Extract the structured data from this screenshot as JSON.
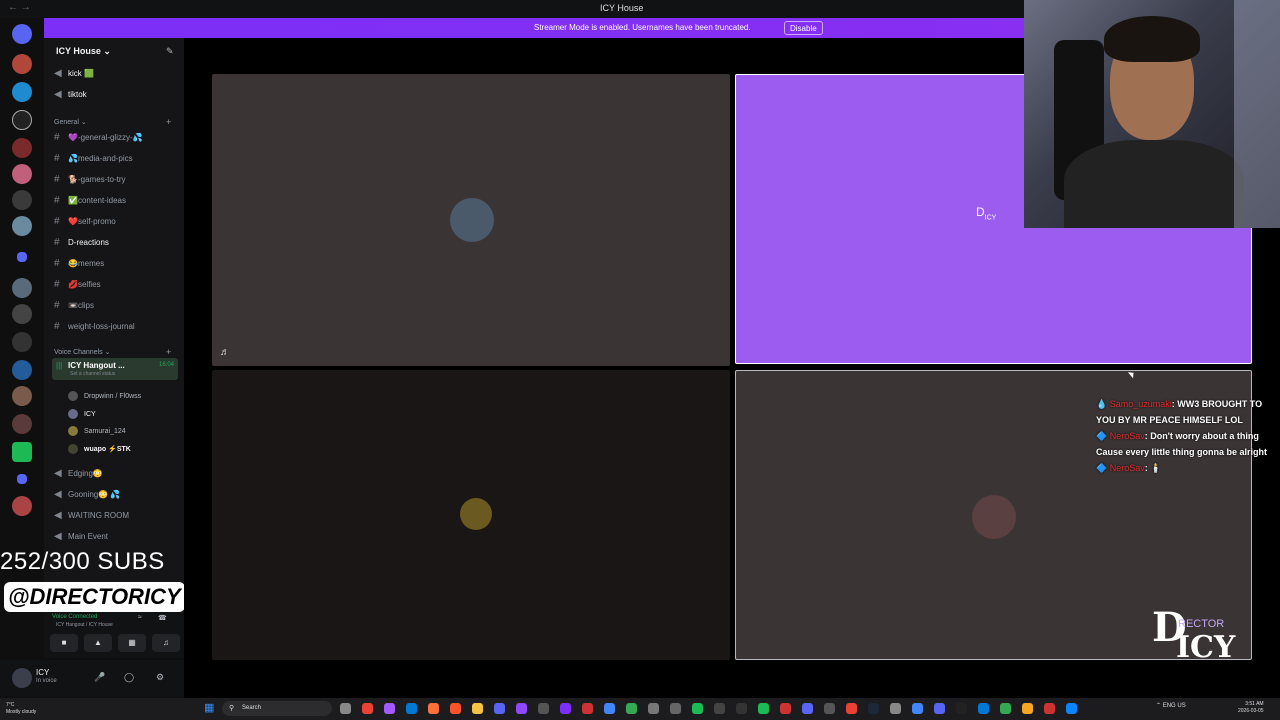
{
  "window": {
    "title": "ICY House"
  },
  "banner": {
    "message": "Streamer Mode is enabled. Usernames have been truncated.",
    "disable_label": "Disable"
  },
  "server": {
    "name": "ICY House ⌄"
  },
  "channels_top": [
    {
      "name": "kick 🟩",
      "icon": "speaker"
    },
    {
      "name": "tiktok",
      "icon": "speaker"
    }
  ],
  "category_general": "General ⌄",
  "text_channels": [
    "💜-general-glizzy-💦",
    "💦media-and-pics",
    "🐕-games-to-try",
    "✅content-ideas",
    "❤️self-promo",
    "D-reactions",
    "😂memes",
    "💋selfies",
    "📼clips",
    "weight-loss-journal"
  ],
  "category_voice": "Voice Channels ⌄",
  "active_voice": {
    "name": "ICY Hangout ...",
    "time": "16:04",
    "status": "Set a channel status"
  },
  "voice_users": [
    "Dropwinn / Fl0wss",
    "ICY",
    "Samurai_124",
    "wuapo ⚡STK"
  ],
  "other_voice": [
    "Edging😳",
    "Gooning😳 💦",
    "WAITING ROOM",
    "Main Event"
  ],
  "overlay": {
    "subs": "252/300 SUBS",
    "handle": "@DIRECTORICY"
  },
  "voicebar": {
    "label": "Voice Connected",
    "sub": "ICY Hangout / ICY House"
  },
  "user": {
    "name": "ICY",
    "status": "In voice"
  },
  "chat": [
    {
      "user": "Samo_uzumaki",
      "text": ": WW3 BROUGHT TO YOU BY MR PEACE HIMSELF LOL"
    },
    {
      "user": "NeroSav",
      "text": ": Don't worry about a thing Cause every little thing gonna be alright"
    },
    {
      "user": "NeroSav",
      "text": ": 🕯️"
    }
  ],
  "logo": {
    "d": "D",
    "rector": "RECTOR",
    "icy": "ICY"
  },
  "taskbar": {
    "weather_temp": "7°C",
    "weather_desc": "Mostly cloudy",
    "search": "Search",
    "lang": "ENG US",
    "time": "3:51 AM",
    "date": "2026-03-05"
  },
  "colors": {
    "accent": "#9c5cf0",
    "banner": "#7b2ff7",
    "voice_green": "#23a55a"
  }
}
